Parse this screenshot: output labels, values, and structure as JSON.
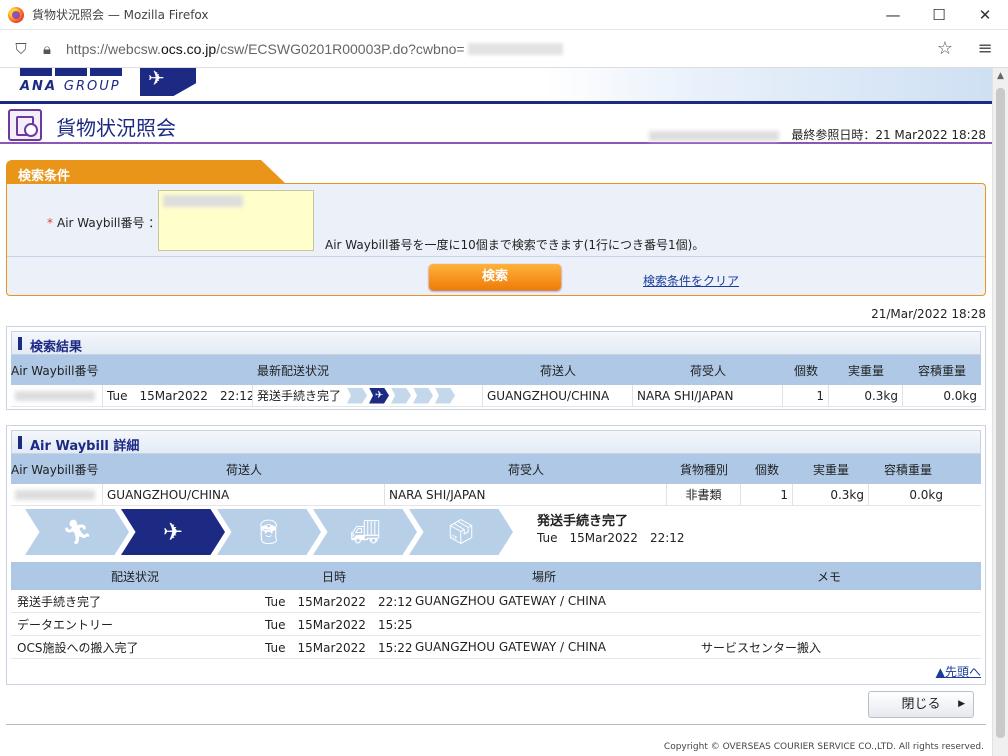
{
  "browser": {
    "window_title": "貨物状況照会 — Mozilla Firefox",
    "url_host": "https://webcsw.",
    "url_domain": "ocs.co.jp",
    "url_path": "/csw/ECSWG0201R00003P.do?cwbno=",
    "minimize": "—",
    "maximize": "☐",
    "close": "✕",
    "bookmark_star": "☆",
    "menu": "≡"
  },
  "header": {
    "logo_word": "ANA",
    "logo_group": "GROUP",
    "page_title": "貨物状況照会",
    "last_ref_label": "最終参照日時：",
    "last_ref_value": "21 Mar2022 18:28"
  },
  "search": {
    "tab_label": "検索条件",
    "required_mark": "*",
    "field_label": "Air Waybill番号 ：",
    "hint": "Air Waybill番号を一度に10個まで検索できます(1行につき番号1個)。",
    "search_button": "検索",
    "clear_link": "検索条件をクリア"
  },
  "result_timestamp": "21/Mar/2022 18:28",
  "results": {
    "title": "検索結果",
    "columns": [
      "Air Waybill番号",
      "最新配送状況",
      "荷送人",
      "荷受人",
      "個数",
      "実重量",
      "容積重量"
    ],
    "row": {
      "date": "Tue　15Mar2022　22:12",
      "status": "発送手続き完了",
      "shipper": "GUANGZHOU/CHINA",
      "consignee": "NARA SHI/JAPAN",
      "pieces": "1",
      "actual_weight": "0.3kg",
      "volume_weight": "0.0kg"
    }
  },
  "detail": {
    "title": "Air Waybill 詳細",
    "columns": [
      "Air Waybill番号",
      "荷送人",
      "荷受人",
      "貨物種別",
      "個数",
      "実重量",
      "容積重量"
    ],
    "row": {
      "shipper": "GUANGZHOU/CHINA",
      "consignee": "NARA SHI/JAPAN",
      "cargo_type": "非書類",
      "pieces": "1",
      "actual_weight": "0.3kg",
      "volume_weight": "0.0kg"
    },
    "status_main": "発送手続き完了",
    "status_date": "Tue　15Mar2022　22:12",
    "history_columns": [
      "配送状況",
      "日時",
      "場所",
      "メモ"
    ],
    "history": [
      {
        "status": "発送手続き完了",
        "date": "Tue　15Mar2022　22:12",
        "place": "GUANGZHOU GATEWAY / CHINA",
        "memo": ""
      },
      {
        "status": "データエントリー",
        "date": "Tue　15Mar2022　15:25",
        "place": "",
        "memo": ""
      },
      {
        "status": "OCS施設への搬入完了",
        "date": "Tue　15Mar2022　15:22",
        "place": "GUANGZHOU GATEWAY / CHINA",
        "memo": "サービスセンター搬入"
      }
    ],
    "to_top": "▲先頭へ"
  },
  "close_button": "閉じる",
  "copyright": "Copyright © OVERSEAS COURIER SERVICE CO.,LTD. All rights reserved."
}
